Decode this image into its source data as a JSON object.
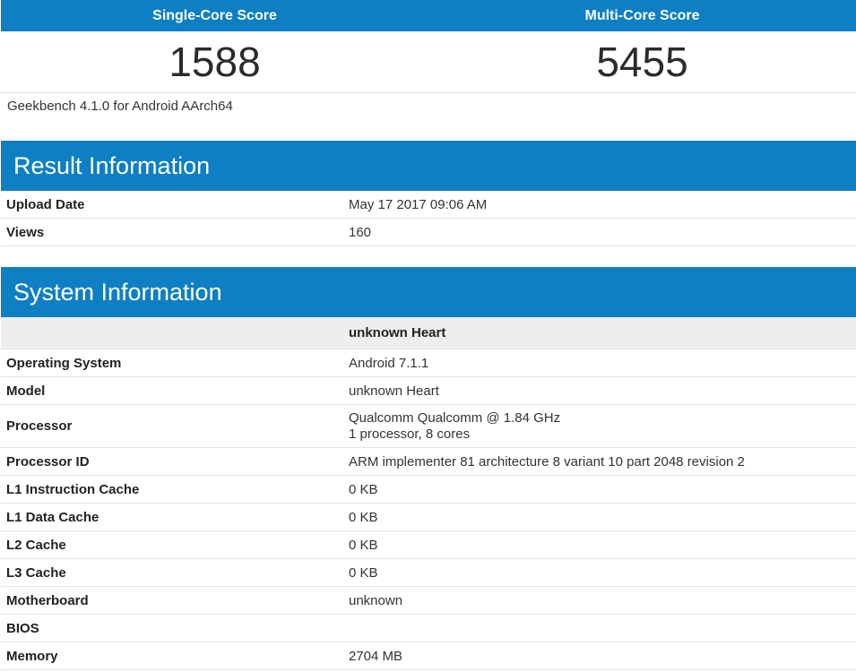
{
  "scores": {
    "single_label": "Single-Core Score",
    "multi_label": "Multi-Core Score",
    "single_value": "1588",
    "multi_value": "5455"
  },
  "version": "Geekbench 4.1.0 for Android AArch64",
  "result": {
    "title": "Result Information",
    "rows": [
      {
        "key": "Upload Date",
        "value": "May 17 2017 09:06 AM"
      },
      {
        "key": "Views",
        "value": "160"
      }
    ]
  },
  "system": {
    "title": "System Information",
    "device": "unknown Heart",
    "rows": [
      {
        "key": "Operating System",
        "value": "Android 7.1.1"
      },
      {
        "key": "Model",
        "value": "unknown Heart"
      },
      {
        "key": "Processor",
        "value": "Qualcomm Qualcomm @ 1.84 GHz",
        "value2": "1 processor, 8 cores"
      },
      {
        "key": "Processor ID",
        "value": "ARM implementer 81 architecture 8 variant 10 part 2048 revision 2"
      },
      {
        "key": "L1 Instruction Cache",
        "value": "0 KB"
      },
      {
        "key": "L1 Data Cache",
        "value": "0 KB"
      },
      {
        "key": "L2 Cache",
        "value": "0 KB"
      },
      {
        "key": "L3 Cache",
        "value": "0 KB"
      },
      {
        "key": "Motherboard",
        "value": "unknown"
      },
      {
        "key": "BIOS",
        "value": ""
      },
      {
        "key": "Memory",
        "value": "2704 MB"
      }
    ]
  },
  "colors": {
    "header_blue": "#0e7fc2",
    "subheader_gray": "#eeeeee"
  }
}
